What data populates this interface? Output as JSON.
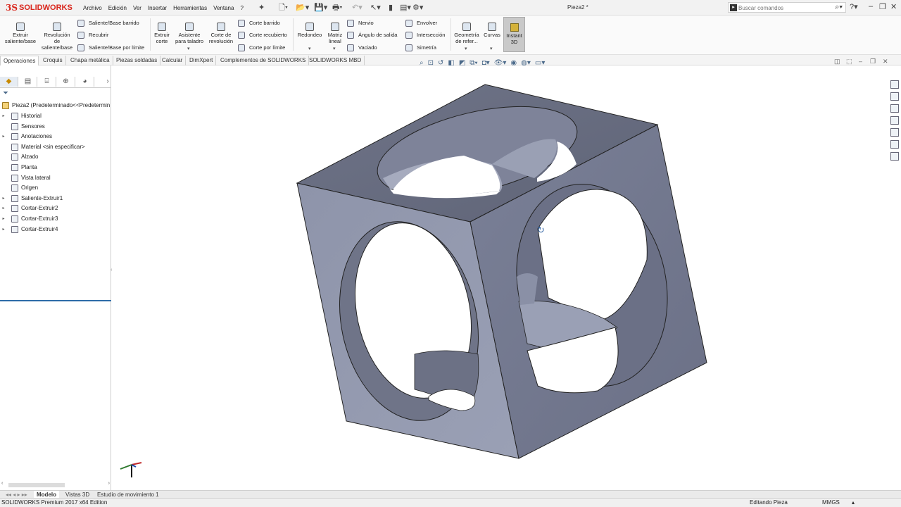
{
  "app": {
    "logo_ds": "3S",
    "logo_name": "SOLIDWORKS",
    "doc_title": "Pieza2 *",
    "menu": [
      "Archivo",
      "Edición",
      "Ver",
      "Insertar",
      "Herramientas",
      "Ventana",
      "?"
    ],
    "search_placeholder": "Buscar comandos"
  },
  "ribbon": {
    "extruir_saliente": "Extruir saliente/base",
    "revolucion_saliente": "Revolución de saliente/base",
    "saliente_barrido": "Saliente/Base barrido",
    "recubrir": "Recubrir",
    "saliente_limite": "Saliente/Base por límite",
    "extruir_corte": "Extruir corte",
    "asistente_taladro": "Asistente para taladro",
    "corte_revolucion": "Corte de revolución",
    "corte_barrido": "Corte barrido",
    "corte_recubierto": "Corte recubierto",
    "corte_limite": "Corte por límite",
    "redondeo": "Redondeo",
    "matriz_lineal": "Matriz lineal",
    "nervio": "Nervio",
    "angulo_salida": "Ángulo de salida",
    "vaciado": "Vaciado",
    "envolver": "Envolver",
    "interseccion": "Intersección",
    "simetria": "Simetría",
    "geometria_ref": "Geometría de refer...",
    "curvas": "Curvas",
    "instant3d": "Instant 3D"
  },
  "tabs": [
    "Operaciones",
    "Croquis",
    "Chapa metálica",
    "Piezas soldadas",
    "Calcular",
    "DimXpert",
    "Complementos de SOLIDWORKS",
    "SOLIDWORKS MBD"
  ],
  "tree": {
    "root": "Pieza2  (Predeterminado<<Predetermin",
    "items": [
      {
        "label": "Historial",
        "expandable": true
      },
      {
        "label": "Sensores",
        "expandable": false
      },
      {
        "label": "Anotaciones",
        "expandable": true
      },
      {
        "label": "Material <sin especificar>",
        "expandable": false
      },
      {
        "label": "Alzado",
        "expandable": false
      },
      {
        "label": "Planta",
        "expandable": false
      },
      {
        "label": "Vista lateral",
        "expandable": false
      },
      {
        "label": "Origen",
        "expandable": false
      },
      {
        "label": "Saliente-Extruir1",
        "expandable": true
      },
      {
        "label": "Cortar-Extruir2",
        "expandable": true
      },
      {
        "label": "Cortar-Extruir3",
        "expandable": true
      },
      {
        "label": "Cortar-Extruir4",
        "expandable": true
      }
    ]
  },
  "bottom_tabs": [
    "Modelo",
    "Vistas 3D",
    "Estudio de movimiento 1"
  ],
  "status": {
    "edition": "SOLIDWORKS Premium 2017 x64 Edition",
    "mode": "Editando Pieza",
    "units": "MMGS"
  },
  "colors": {
    "model_light": "#8d93ab",
    "model_dark": "#6a6f84",
    "brand": "#d9261c"
  }
}
